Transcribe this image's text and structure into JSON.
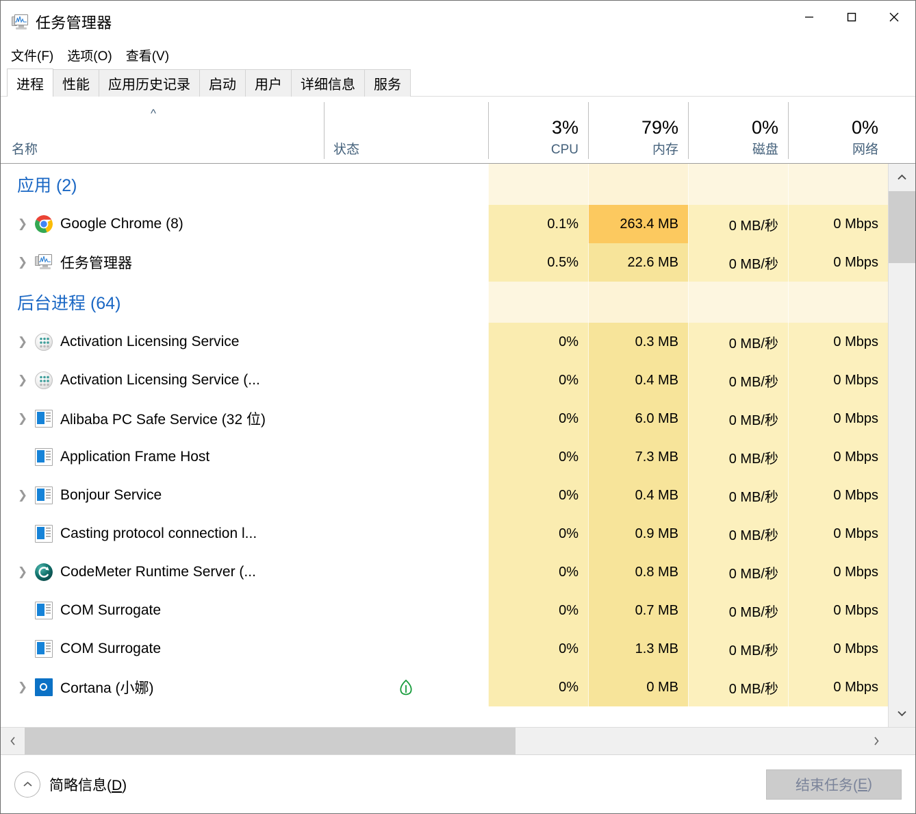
{
  "window": {
    "title": "任务管理器",
    "icon": "task-manager-icon",
    "controls": {
      "minimize": "—",
      "maximize": "□",
      "close": "✕"
    }
  },
  "menubar": {
    "items": [
      {
        "label": "文件(F)"
      },
      {
        "label": "选项(O)"
      },
      {
        "label": "查看(V)"
      }
    ]
  },
  "tabs": {
    "active_index": 0,
    "items": [
      {
        "label": "进程"
      },
      {
        "label": "性能"
      },
      {
        "label": "应用历史记录"
      },
      {
        "label": "启动"
      },
      {
        "label": "用户"
      },
      {
        "label": "详细信息"
      },
      {
        "label": "服务"
      }
    ]
  },
  "columns": {
    "sort_indicator": "^",
    "items": [
      {
        "key": "name",
        "label": "名称",
        "percent": ""
      },
      {
        "key": "status",
        "label": "状态",
        "percent": ""
      },
      {
        "key": "cpu",
        "label": "CPU",
        "percent": "3%"
      },
      {
        "key": "memory",
        "label": "内存",
        "percent": "79%"
      },
      {
        "key": "disk",
        "label": "磁盘",
        "percent": "0%"
      },
      {
        "key": "network",
        "label": "网络",
        "percent": "0%"
      }
    ]
  },
  "rows": [
    {
      "type": "group",
      "title": "应用 (2)",
      "cpu": "",
      "memory": "",
      "disk": "",
      "network": "",
      "status": ""
    },
    {
      "type": "process",
      "expandable": true,
      "icon": "chrome-icon",
      "name": "Google Chrome (8)",
      "status": "",
      "cpu": "0.1%",
      "memory": "263.4 MB",
      "memory_hot": true,
      "disk": "0 MB/秒",
      "network": "0 Mbps"
    },
    {
      "type": "process",
      "expandable": true,
      "icon": "task-manager-icon",
      "name": "任务管理器",
      "status": "",
      "cpu": "0.5%",
      "memory": "22.6 MB",
      "memory_hot": false,
      "disk": "0 MB/秒",
      "network": "0 Mbps"
    },
    {
      "type": "group",
      "title": "后台进程 (64)",
      "cpu": "",
      "memory": "",
      "disk": "",
      "network": "",
      "status": ""
    },
    {
      "type": "process",
      "expandable": true,
      "icon": "service-icon",
      "name": "Activation Licensing Service",
      "status": "",
      "cpu": "0%",
      "memory": "0.3 MB",
      "memory_hot": false,
      "disk": "0 MB/秒",
      "network": "0 Mbps"
    },
    {
      "type": "process",
      "expandable": true,
      "icon": "service-icon",
      "name": "Activation Licensing Service (...",
      "status": "",
      "cpu": "0%",
      "memory": "0.4 MB",
      "memory_hot": false,
      "disk": "0 MB/秒",
      "network": "0 Mbps"
    },
    {
      "type": "process",
      "expandable": true,
      "icon": "windows-app-icon",
      "name": "Alibaba PC Safe Service (32 位)",
      "status": "",
      "cpu": "0%",
      "memory": "6.0 MB",
      "memory_hot": false,
      "disk": "0 MB/秒",
      "network": "0 Mbps"
    },
    {
      "type": "process",
      "expandable": false,
      "icon": "windows-app-icon",
      "name": "Application Frame Host",
      "status": "",
      "cpu": "0%",
      "memory": "7.3 MB",
      "memory_hot": false,
      "disk": "0 MB/秒",
      "network": "0 Mbps"
    },
    {
      "type": "process",
      "expandable": true,
      "icon": "windows-app-icon",
      "name": "Bonjour Service",
      "status": "",
      "cpu": "0%",
      "memory": "0.4 MB",
      "memory_hot": false,
      "disk": "0 MB/秒",
      "network": "0 Mbps"
    },
    {
      "type": "process",
      "expandable": false,
      "icon": "windows-app-icon",
      "name": "Casting protocol connection l...",
      "status": "",
      "cpu": "0%",
      "memory": "0.9 MB",
      "memory_hot": false,
      "disk": "0 MB/秒",
      "network": "0 Mbps"
    },
    {
      "type": "process",
      "expandable": true,
      "icon": "codemeter-icon",
      "name": "CodeMeter Runtime Server (...",
      "status": "",
      "cpu": "0%",
      "memory": "0.8 MB",
      "memory_hot": false,
      "disk": "0 MB/秒",
      "network": "0 Mbps"
    },
    {
      "type": "process",
      "expandable": false,
      "icon": "windows-app-icon",
      "name": "COM Surrogate",
      "status": "",
      "cpu": "0%",
      "memory": "0.7 MB",
      "memory_hot": false,
      "disk": "0 MB/秒",
      "network": "0 Mbps"
    },
    {
      "type": "process",
      "expandable": false,
      "icon": "windows-app-icon",
      "name": "COM Surrogate",
      "status": "",
      "cpu": "0%",
      "memory": "1.3 MB",
      "memory_hot": false,
      "disk": "0 MB/秒",
      "network": "0 Mbps"
    },
    {
      "type": "process",
      "expandable": true,
      "icon": "cortana-icon",
      "name": "Cortana (小娜)",
      "status": "leaf-icon",
      "cpu": "0%",
      "memory": "0 MB",
      "memory_hot": false,
      "disk": "0 MB/秒",
      "network": "0 Mbps"
    }
  ],
  "scrollbars": {
    "vertical": {
      "up": "⌃",
      "down": "⌄"
    },
    "horizontal": {
      "left": "‹",
      "right": "›"
    }
  },
  "statusbar": {
    "fewer_details_label": "简略信息(D)",
    "fewer_details_accel": "D",
    "collapse_icon": "⌃",
    "end_task_label": "结束任务(E)",
    "end_task_accel": "E",
    "end_task_disabled": true
  },
  "colors": {
    "group_title": "#1a67c4",
    "column_label": "#44617b",
    "cpu_tint": "#faecb0",
    "memory_tint": "#f7e49a",
    "disk_tint": "#fcf0bd",
    "network_tint": "#fcf0bd",
    "memory_hot": "#fcc95f",
    "leaf_green": "#169b3a",
    "chrome_blue": "#4285f4",
    "accent_blue": "#0b71c5"
  }
}
